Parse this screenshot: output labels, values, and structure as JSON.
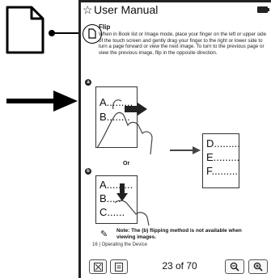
{
  "window": {
    "title": "User Manual"
  },
  "content": {
    "section_heading": "Flip",
    "description": "When in Book list or Image mode, place your finger on the left or upper side of the touch screen and gently drag your finger to the right or lower side to turn a page forward or view the next image. To turn to the previous page or view the previous image, flip in the opposite direction.",
    "step_a_num": "a",
    "step_b_num": "b",
    "page1_lines": [
      "A.........",
      "B........"
    ],
    "page2_lines": [
      "D.........",
      "E.........",
      "F........."
    ],
    "page3_lines": [
      "A.........",
      "B.....",
      "C......"
    ],
    "or_label": "Or",
    "note": "Note: The (b) flipping method is not available when viewing images.",
    "footer_ref": "16 | Operating the Device"
  },
  "footer": {
    "page_indicator": "23 of 70"
  },
  "icons": {
    "callout": "document-icon",
    "arrow": "right-arrow-icon",
    "star": "star-icon",
    "battery": "battery-icon",
    "zoom_out": "zoom-out-icon",
    "zoom_in": "zoom-in-icon"
  }
}
